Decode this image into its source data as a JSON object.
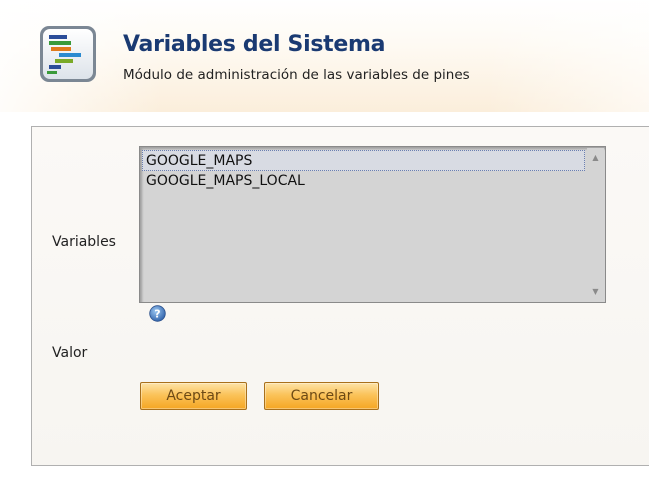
{
  "header": {
    "title": "Variables del Sistema",
    "subtitle": "Módulo de administración de las variables de pines",
    "icon": "list-gantt-icon"
  },
  "form": {
    "variables_label": "Variables",
    "valor_label": "Valor",
    "variables_list": {
      "items": [
        {
          "label": "GOOGLE_MAPS",
          "selected": true
        },
        {
          "label": "GOOGLE_MAPS_LOCAL",
          "selected": false
        }
      ]
    },
    "help_icon": "question-mark-icon",
    "accept_label": "Aceptar",
    "cancel_label": "Cancelar"
  },
  "colors": {
    "title": "#1a3a72",
    "button": "#f5a623",
    "listbox_bg": "#d4d4d4"
  }
}
